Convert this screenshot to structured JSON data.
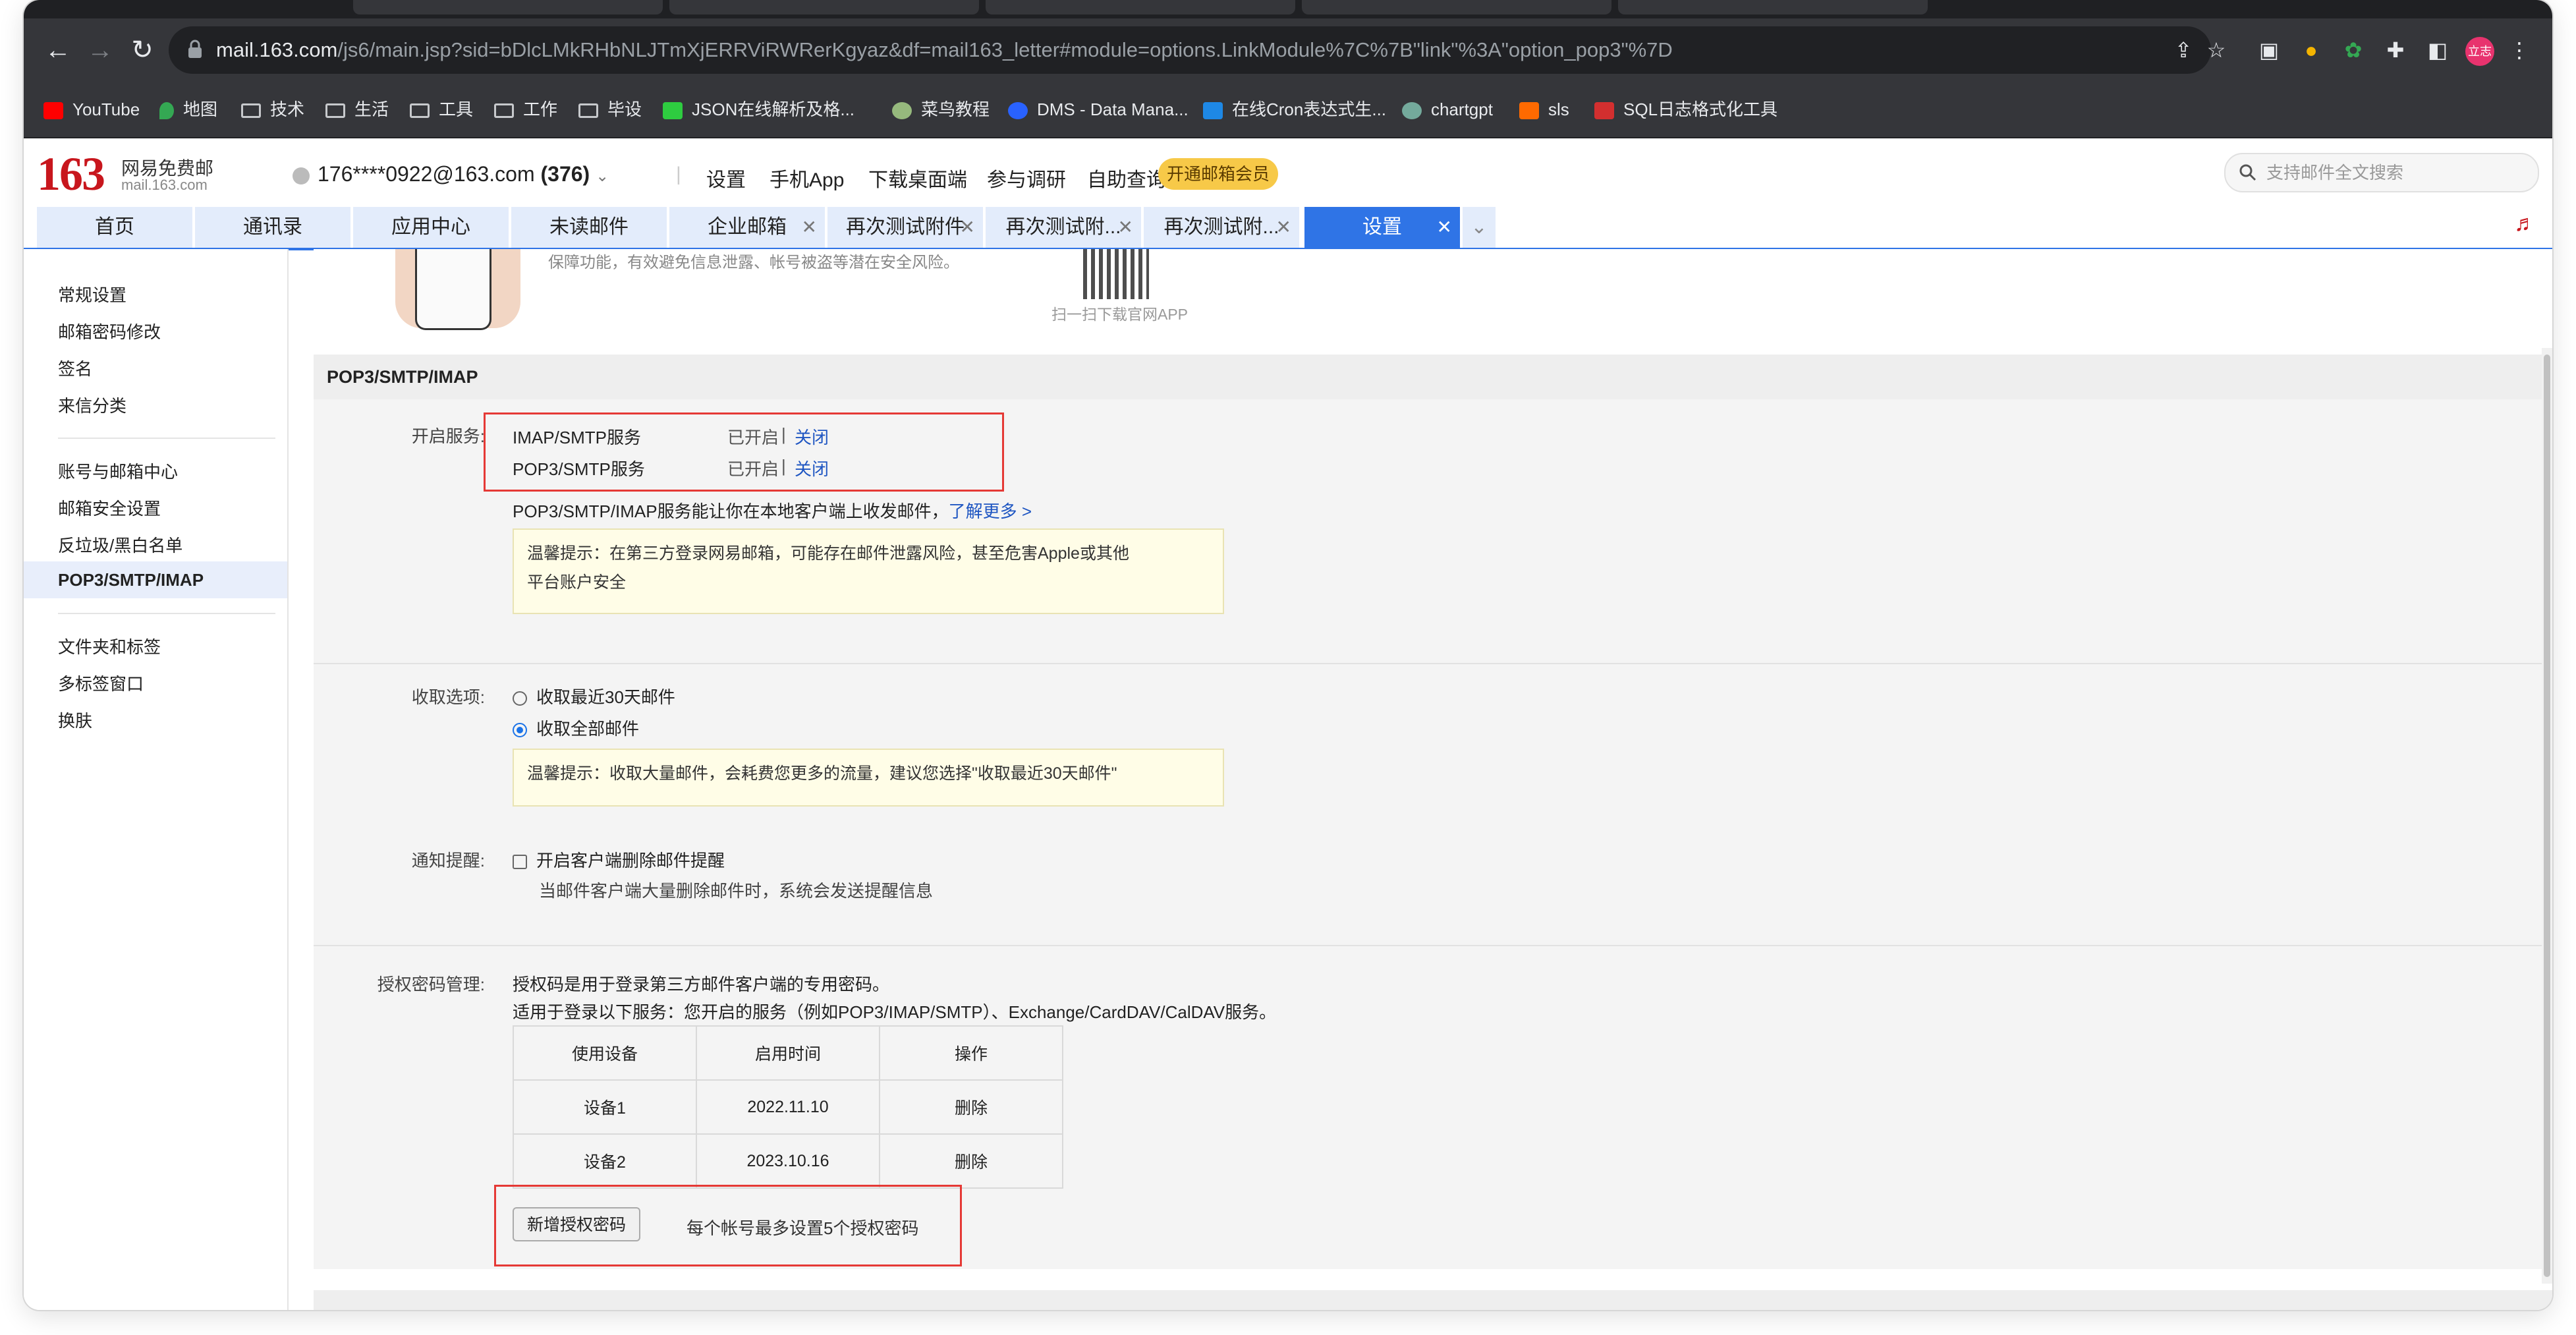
{
  "browser": {
    "url_host": "mail.163.com",
    "url_rest": "/js6/main.jsp?sid=bDlcLMkRHbNLJTmXjERRViRWRerKgyaz&df=mail163_letter#module=options.LinkModule%7C%7B\"link\"%3A\"option_pop3\"%7D",
    "profile_badge": "立志",
    "bookmarks": [
      "YouTube",
      "地图",
      "技术",
      "生活",
      "工具",
      "工作",
      "毕设",
      "JSON在线解析及格...",
      "菜鸟教程",
      "DMS - Data Mana...",
      "在线Cron表达式生...",
      "chartgpt",
      "sls",
      "SQL日志格式化工具"
    ]
  },
  "header": {
    "logo_number": "163",
    "logo_name": "网易免费邮",
    "logo_domain": "mail.163.com",
    "account": "176****0922@163.com",
    "unread_count": "(376)",
    "links": [
      "设置",
      "手机App",
      "下载桌面端",
      "参与调研",
      "自助查询"
    ],
    "vip_label": "开通邮箱会员",
    "search_placeholder": "支持邮件全文搜索"
  },
  "tabs": [
    "首页",
    "通讯录",
    "应用中心",
    "未读邮件",
    "企业邮箱",
    "再次测试附件",
    "再次测试附...",
    "再次测试附...",
    "设置"
  ],
  "nav": {
    "group1": [
      "常规设置",
      "邮箱密码修改",
      "签名",
      "来信分类"
    ],
    "group2": [
      "账号与邮箱中心",
      "邮箱安全设置",
      "反垃圾/黑白名单",
      "POP3/SMTP/IMAP"
    ],
    "group3": [
      "文件夹和标签",
      "多标签窗口",
      "换肤"
    ]
  },
  "banner": {
    "text": "保障功能，有效避免信息泄露、帐号被盗等潜在安全风险。",
    "qr_caption": "扫一扫下载官网APP"
  },
  "section_title": "POP3/SMTP/IMAP",
  "services": {
    "label": "开启服务:",
    "rows": [
      {
        "name": "IMAP/SMTP服务",
        "status": "已开启",
        "sep": "|",
        "action": "关闭"
      },
      {
        "name": "POP3/SMTP服务",
        "status": "已开启",
        "sep": "|",
        "action": "关闭"
      }
    ],
    "desc": "POP3/SMTP/IMAP服务能让你在本地客户端上收发邮件，",
    "learn_more": "了解更多 >",
    "tip_line1": "温馨提示：在第三方登录网易邮箱，可能存在邮件泄露风险，甚至危害Apple或其他",
    "tip_line2": "平台账户安全"
  },
  "receive": {
    "label": "收取选项:",
    "option1": "收取最近30天邮件",
    "option2": "收取全部邮件",
    "selected": "收取全部邮件",
    "tip": "温馨提示：收取大量邮件，会耗费您更多的流量，建议您选择\"收取最近30天邮件\""
  },
  "notify": {
    "label": "通知提醒:",
    "checkbox_label": "开启客户端删除邮件提醒",
    "desc": "当邮件客户端大量删除邮件时，系统会发送提醒信息"
  },
  "auth": {
    "label": "授权密码管理:",
    "desc1": "授权码是用于登录第三方邮件客户端的专用密码。",
    "desc2": "适用于登录以下服务：您开启的服务（例如POP3/IMAP/SMTP）、Exchange/CardDAV/CalDAV服务。",
    "columns": [
      "使用设备",
      "启用时间",
      "操作"
    ],
    "rows": [
      {
        "device": "设备1",
        "date": "2022.11.10",
        "action": "删除"
      },
      {
        "device": "设备2",
        "date": "2023.10.16",
        "action": "删除"
      }
    ],
    "add_button": "新增授权密码",
    "limit_note": "每个帐号最多设置5个授权密码"
  },
  "colors": {
    "brand_red": "#c8161d",
    "tab_blue": "#2f74e6",
    "link_blue": "#1f56c2",
    "highlight_red": "#e53935"
  }
}
